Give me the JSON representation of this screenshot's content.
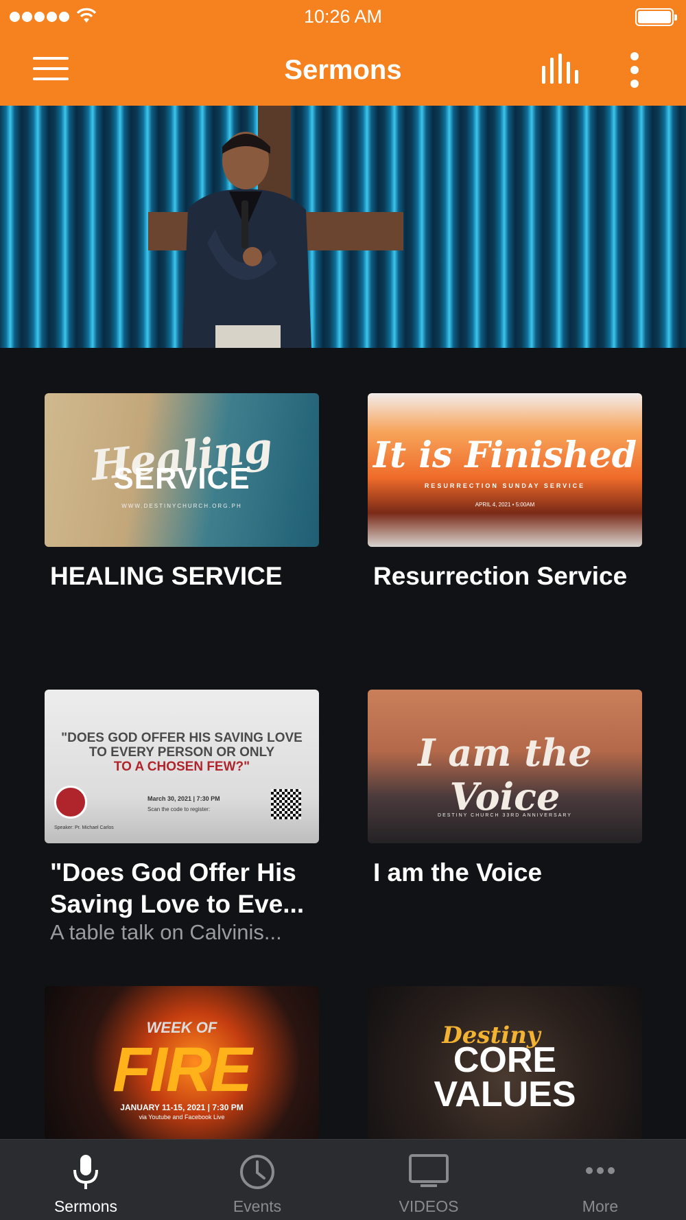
{
  "status_bar": {
    "time": "10:26 AM"
  },
  "nav": {
    "title": "Sermons",
    "menu_icon": "hamburger-icon",
    "bars_icon": "audio-bars-icon",
    "more_icon": "kebab-icon"
  },
  "colors": {
    "accent": "#f5821f",
    "background": "#111215",
    "tabbar": "#2b2c2f",
    "subtitle": "#9a9ba0"
  },
  "hero": {
    "image": "sermon-hero-image"
  },
  "sermons": [
    {
      "title": "HEALING SERVICE",
      "subtitle": "",
      "thumb": {
        "script": "Healing",
        "line": "SERVICE",
        "url": "WWW.DESTINYCHURCH.ORG.PH"
      }
    },
    {
      "title": "Resurrection Service",
      "subtitle": "",
      "thumb": {
        "script": "It is Finished",
        "line": "RESURRECTION SUNDAY SERVICE",
        "date": "APRIL 4, 2021 • 5:00AM"
      }
    },
    {
      "title": "\"Does God Offer His Saving Love to Eve...",
      "subtitle": "A table talk on Calvinis...",
      "thumb": {
        "line1": "\"DOES GOD OFFER HIS SAVING LOVE",
        "line2": "TO EVERY PERSON OR ONLY",
        "line3": "TO A CHOSEN FEW?\"",
        "date": "March 30, 2021 | 7:30 PM",
        "scan": "Scan the code to register:",
        "speaker": "Speaker: Pr. Michael Carlos"
      }
    },
    {
      "title": "I am the Voice",
      "subtitle": "",
      "thumb": {
        "script": "I am the Voice",
        "line": "DESTINY CHURCH 33RD ANNIVERSARY"
      }
    },
    {
      "title": "",
      "subtitle": "",
      "thumb": {
        "top": "WEEK OF",
        "big": "FIRE",
        "date": "JANUARY 11-15, 2021 | 7:30 PM",
        "via": "via Youtube and Facebook Live"
      }
    },
    {
      "title": "",
      "subtitle": "",
      "thumb": {
        "script": "Destiny",
        "line1": "CORE",
        "line2": "VALUES"
      }
    }
  ],
  "tabs": [
    {
      "label": "Sermons",
      "icon": "microphone-icon",
      "active": true
    },
    {
      "label": "Events",
      "icon": "clock-icon",
      "active": false
    },
    {
      "label": "VIDEOS",
      "icon": "tv-icon",
      "active": false
    },
    {
      "label": "More",
      "icon": "more-dots-icon",
      "active": false
    }
  ]
}
